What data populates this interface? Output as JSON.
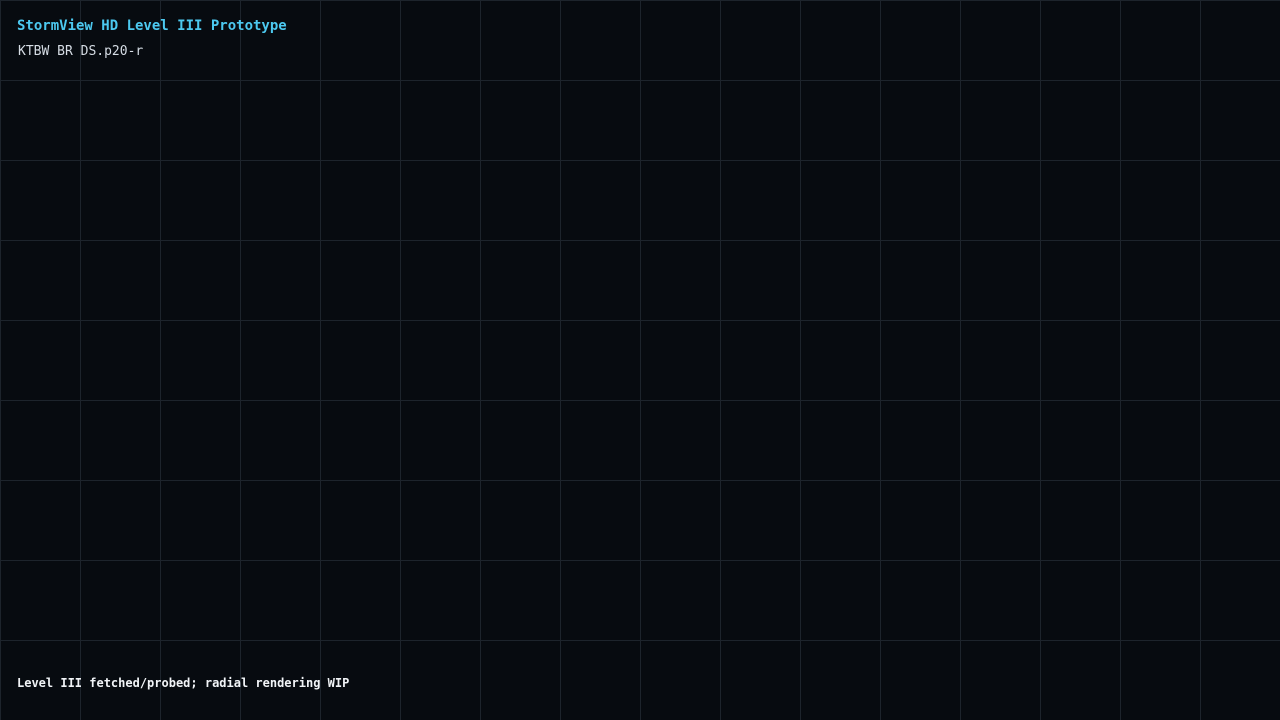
{
  "header": {
    "title": "StormView HD Level III Prototype",
    "product_line": "KTBW BR DS.p20-r"
  },
  "status": {
    "message": "Level III fetched/probed; radial rendering WIP"
  },
  "colors": {
    "background": "#070b10",
    "grid": "#1d242c",
    "title": "#4cc9f0",
    "product_line": "#d6dde5",
    "status": "#f1f4f7"
  }
}
